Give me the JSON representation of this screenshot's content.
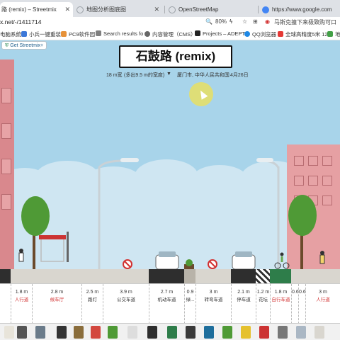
{
  "browser": {
    "tabs": [
      {
        "label": "路 (remix) – Streetmix",
        "active": true,
        "favicon_color": "#e84c3d"
      },
      {
        "label": "地图分析图底图",
        "active": false,
        "favicon_color": "#9aa0a6"
      },
      {
        "label": "OpenStreetMap",
        "active": false,
        "favicon_color": "#9aa0a6"
      },
      {
        "label": "https://www.google.com",
        "active": false,
        "favicon_color": "#4285f4"
      }
    ],
    "url": "x.net/-/1411714",
    "zoom": "80%",
    "right_text": "马斯克撞下来极致购可口",
    "bookmarks": [
      {
        "label": "电脑系统",
        "color": "#6aa84f"
      },
      {
        "label": "小兵一键重装",
        "color": "#3c78d8"
      },
      {
        "label": "PC9软件园",
        "color": "#e69138"
      },
      {
        "label": "Search results fo",
        "color": "#7f7f7f"
      },
      {
        "label": "内容管理（CMS）",
        "color": "#666666"
      },
      {
        "label": "Projects – ADEPT",
        "color": "#222222"
      },
      {
        "label": "QQ浏览器",
        "color": "#1e88e5"
      },
      {
        "label": "全球高精度5米 12.",
        "color": "#e53935"
      },
      {
        "label": "地",
        "color": "#43a047"
      }
    ]
  },
  "streetmix": {
    "get_streetmix": "Get Streetmix+",
    "street_name": "石鼓路 (remix)",
    "width_text": "18 m宽",
    "width_warning": "(多出9.5 m的宽度)",
    "location": "厦门市, 中华人民共和国",
    "date": "4月26日",
    "segments": [
      {
        "width": "1.8 m",
        "name": "人行道",
        "red": true
      },
      {
        "width": "2.8 m",
        "name": "候车厅",
        "red": true
      },
      {
        "width": "2.5 m",
        "name": "路灯",
        "red": false
      },
      {
        "width": "3.9 m",
        "name": "公交车道",
        "red": false
      },
      {
        "width": "2.7 m",
        "name": "机动车道",
        "red": false
      },
      {
        "width": "0.9",
        "name": "绿...",
        "red": false
      },
      {
        "width": "3 m",
        "name": "转弯车道",
        "red": false
      },
      {
        "width": "2.1 m",
        "name": "停车道",
        "red": false
      },
      {
        "width": "1.2 m",
        "name": "花坛",
        "red": false
      },
      {
        "width": "1.8 m",
        "name": "自行车道",
        "red": true
      },
      {
        "width": "0.6",
        "name": "",
        "red": false
      },
      {
        "width": "0.6",
        "name": "",
        "red": false
      },
      {
        "width": "3 m",
        "name": "人行道",
        "red": true
      }
    ]
  },
  "colors": {
    "sky": "#a8d4ea",
    "building": "#d9888d",
    "bus_lane": "#2e2e2e",
    "accent_red": "#d23030"
  }
}
